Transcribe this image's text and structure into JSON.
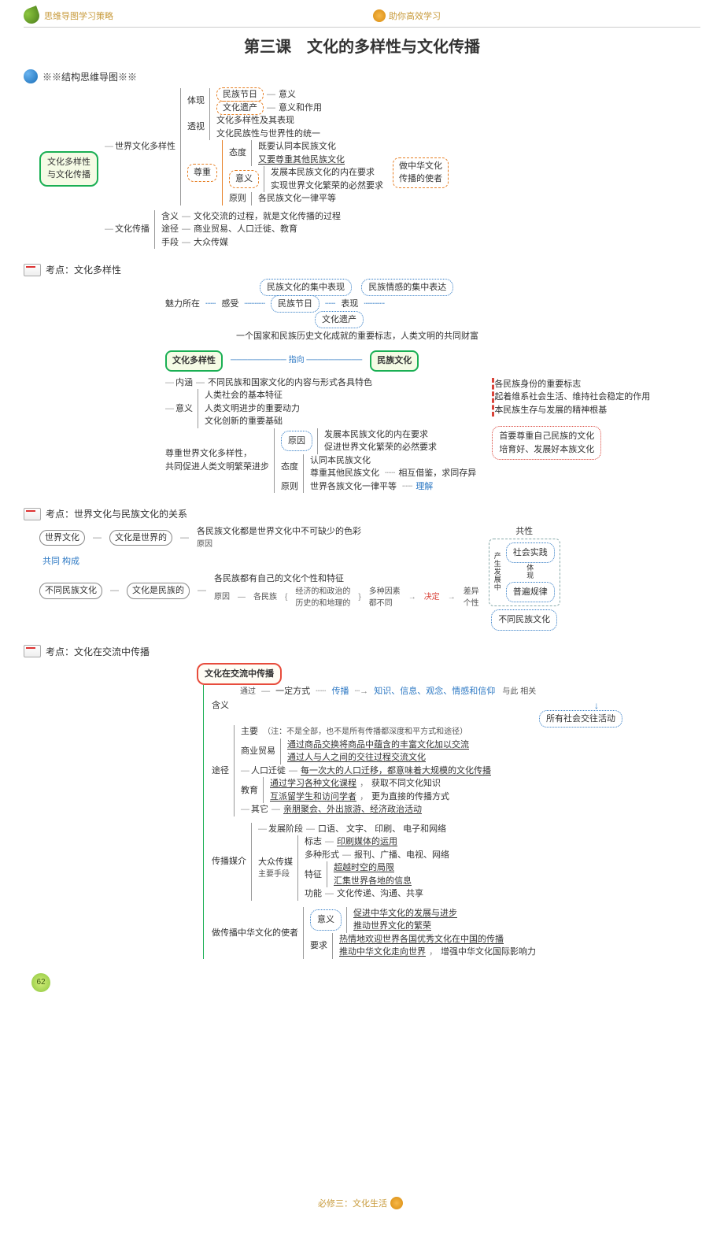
{
  "header": {
    "left": "思维导图学习策略",
    "right": "助你高效学习"
  },
  "title": "第三课　文化的多样性与文化传播",
  "sections": {
    "structure": "※※结构思维导图※※",
    "p1": "考点：文化多样性",
    "p2": "考点：世界文化与民族文化的关系",
    "p3": "考点：文化在交流中传播"
  },
  "map1": {
    "root": "文化多样性\n与文化传播",
    "a": "世界文化多样性",
    "a1": "体现",
    "a1a": "民族节日",
    "a1a2": "意义",
    "a1b": "文化遗产",
    "a1b2": "意义和作用",
    "a2": "透视",
    "a2a": "文化多样性及其表现",
    "a2b": "文化民族性与世界性的统一",
    "a3": "尊重",
    "a3a": "态度",
    "a3a1": "既要认同本民族文化",
    "a3a2": "又要尊重其他民族文化",
    "a3b": "意义",
    "a3b1": "发展本民族文化的内在要求",
    "a3b2": "实现世界文化繁荣的必然要求",
    "a3c": "原则",
    "a3c1": "各民族文化一律平等",
    "a3side": "做中华文化\n传播的使者",
    "b": "文化传播",
    "b1": "含义",
    "b1a": "文化交流的过程，就是文化传播的过程",
    "b2": "途径",
    "b2a": "商业贸易、人口迁徙、教育",
    "b3": "手段",
    "b3a": "大众传媒"
  },
  "map2": {
    "top1": "民族文化的集中表现",
    "top2": "民族情感的集中表达",
    "midA": "魅力所在",
    "midB": "感受",
    "midC": "民族节日",
    "midD": "表现",
    "midE": "文化遗产",
    "desc": "一个国家和民族历史文化成就的重要标志，人类文明的共同财富",
    "left": "文化多样性",
    "right": "民族文化",
    "rel": "指向",
    "lr1": "内涵",
    "lr1a": "不同民族和国家文化的内容与形式各具特色",
    "r1": "各民族身份的重要标志",
    "r2": "起着维系社会生活、维持社会稳定的作用",
    "r3": "本民族生存与发展的精神根基",
    "yi": "意义",
    "yi1": "人类社会的基本特征",
    "yi2": "人类文明进步的重要动力",
    "yi3": "文化创新的重要基础",
    "zj": "尊重世界文化多样性，\n共同促进人类文明繁荣进步",
    "zj_ry": "原因",
    "zj_ry1": "发展本民族文化的内在要求",
    "zj_ry2": "促进世界文化繁荣的必然要求",
    "zj_td": "态度",
    "zj_td1": "认同本民族文化",
    "zj_td2": "尊重其他民族文化",
    "zj_td_side": "相互借鉴，求同存异",
    "zj_td_side2": "理解",
    "zj_yz": "原则",
    "zj_yz1": "世界各族文化一律平等",
    "right_side1": "首要尊重自己民族的文化",
    "right_side2": "培育好、发展好本族文化"
  },
  "map3": {
    "wl": "世界文化",
    "ml": "不同民族文化",
    "link": "共同 构成",
    "wl_l": "文化是世界的",
    "wl_r1": "各民族文化都是世界文化中不可缺少的色彩",
    "wl_r0": "原因",
    "ml_l": "文化是民族的",
    "ml_r1": "各民族都有自己的文化个性和特征",
    "ml_r0": "原因",
    "ml_r2": "各民族",
    "ml_r2a": "经济的和政治的",
    "ml_r2b": "历史的和地理的",
    "ml_r2c": "多种因素\n都不同",
    "dc": "决定",
    "cs": "差异\n个性",
    "rbox_head": "共性",
    "rbox_a": "社会实践",
    "rbox_b": "共性",
    "rbox_c": "普遍规律",
    "rbox_d": "不同民族文化",
    "rbox_mid1": "产",
    "rbox_mid2": "生",
    "rbox_mid3": "发",
    "rbox_mid4": "展",
    "rbox_mid5": "中",
    "rbox_mid6": "体",
    "rbox_mid7": "现"
  },
  "map4": {
    "root": "文化在交流中传播",
    "hy": "含义",
    "hy_t": "通过",
    "hy_a": "一定方式",
    "hy_b": "传播",
    "hy_c": "知识、信息、观念、情感和信仰",
    "hy_d": "与此 相关",
    "hy_e": "所有社会交往活动",
    "tj": "途径",
    "tj_main": "主要",
    "tj_note": "（注：不是全部，也不是所有传播都深度和平方式和途径）",
    "tj1": "商业贸易",
    "tj1a": "通过商品交换将商品中蕴含的丰富文化加以交流",
    "tj1b": "通过人与人之间的交往过程交流文化",
    "tj2": "人口迁徙",
    "tj2a": "每一次大的人口迁移，都意味着大规模的文化传播",
    "tj3": "教育",
    "tj3a": "通过学习各种文化课程",
    "tj3a2": "获取不同文化知识",
    "tj3b": "互派留学生和访问学者",
    "tj3b2": "更为直接的传播方式",
    "tj4": "其它",
    "tj4a": "亲朋聚会、外出旅游、经济政治活动",
    "cm": "传播媒介",
    "cm1": "发展阶段",
    "cm1a": "口语、 文字、 印刷、 电子和网络",
    "cm2": "大众传媒",
    "cm2_red": "主要手段",
    "cm2a": "标志",
    "cm2a1": "印刷媒体的运用",
    "cm2b": "多种形式",
    "cm2b1": "报刊、广播、电视、网络",
    "cm2c": "特征",
    "cm2c1": "超越时空的局限",
    "cm2c2": "汇集世界各地的信息",
    "cm2d": "功能",
    "cm2d1": "文化传递、沟通、共享",
    "sz": "做传播中华文化的使者",
    "sz1": "意义",
    "sz1a": "促进中华文化的发展与进步",
    "sz1b": "推动世界文化的繁荣",
    "sz2": "要求",
    "sz2a": "热情地欢迎世界各国优秀文化在中国的传播",
    "sz2b": "推动中华文化走向世界",
    "sz2b2": "增强中华文化国际影响力"
  },
  "footer": {
    "text": "必修三：文化生活",
    "page": "62"
  }
}
